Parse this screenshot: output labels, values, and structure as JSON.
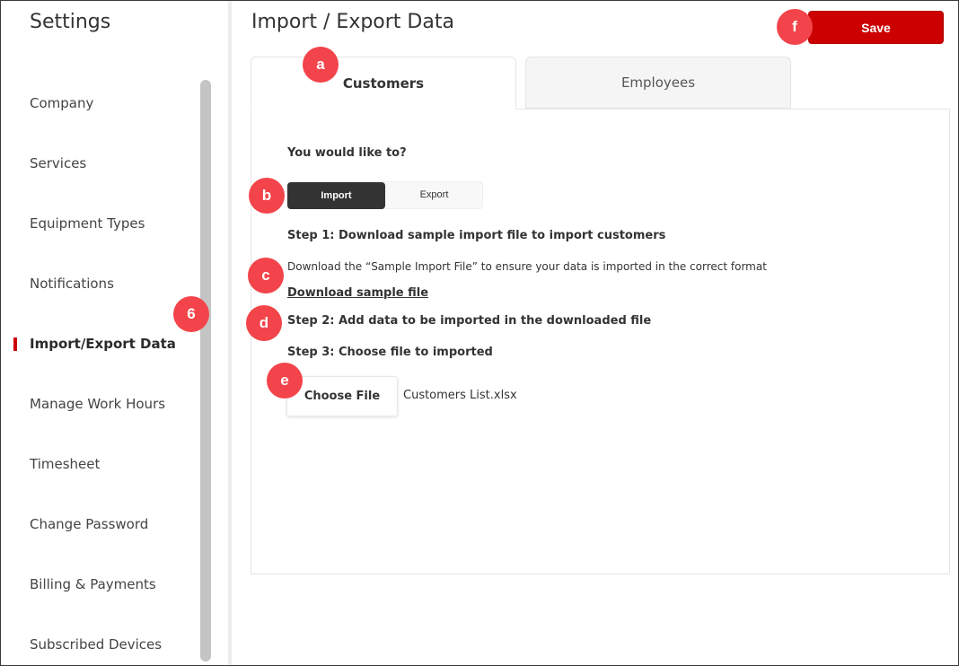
{
  "sidebar": {
    "title": "Settings",
    "items": [
      {
        "label": "Company"
      },
      {
        "label": "Services"
      },
      {
        "label": "Equipment Types"
      },
      {
        "label": "Notifications"
      },
      {
        "label": "Import/Export Data",
        "active": true
      },
      {
        "label": "Manage Work Hours"
      },
      {
        "label": "Timesheet"
      },
      {
        "label": "Change Password"
      },
      {
        "label": "Billing & Payments"
      },
      {
        "label": "Subscribed Devices"
      }
    ]
  },
  "header": {
    "title": "Import / Export Data",
    "save_label": "Save"
  },
  "tabs": [
    {
      "label": "Customers",
      "selected": true
    },
    {
      "label": "Employees",
      "selected": false
    }
  ],
  "content": {
    "question": "You would like to?",
    "toggle": {
      "import_label": "Import",
      "export_label": "Export",
      "selected": "Import"
    },
    "step1": "Step 1: Download sample import file to import customers",
    "step1_desc": "Download the “Sample Import File” to ensure your data is imported in the correct format",
    "download_link": "Download sample file",
    "step2": "Step 2: Add data to be imported in the downloaded file",
    "step3": "Step 3: Choose file to imported",
    "choose_file_label": "Choose File",
    "file_name": "Customers List.xlsx"
  },
  "annotations": {
    "a": "a",
    "b": "b",
    "c": "c",
    "d": "d",
    "e": "e",
    "f": "f",
    "six": "6"
  },
  "colors": {
    "accent": "#cc0000",
    "badge": "#f2444a",
    "toggle_active": "#333333"
  }
}
